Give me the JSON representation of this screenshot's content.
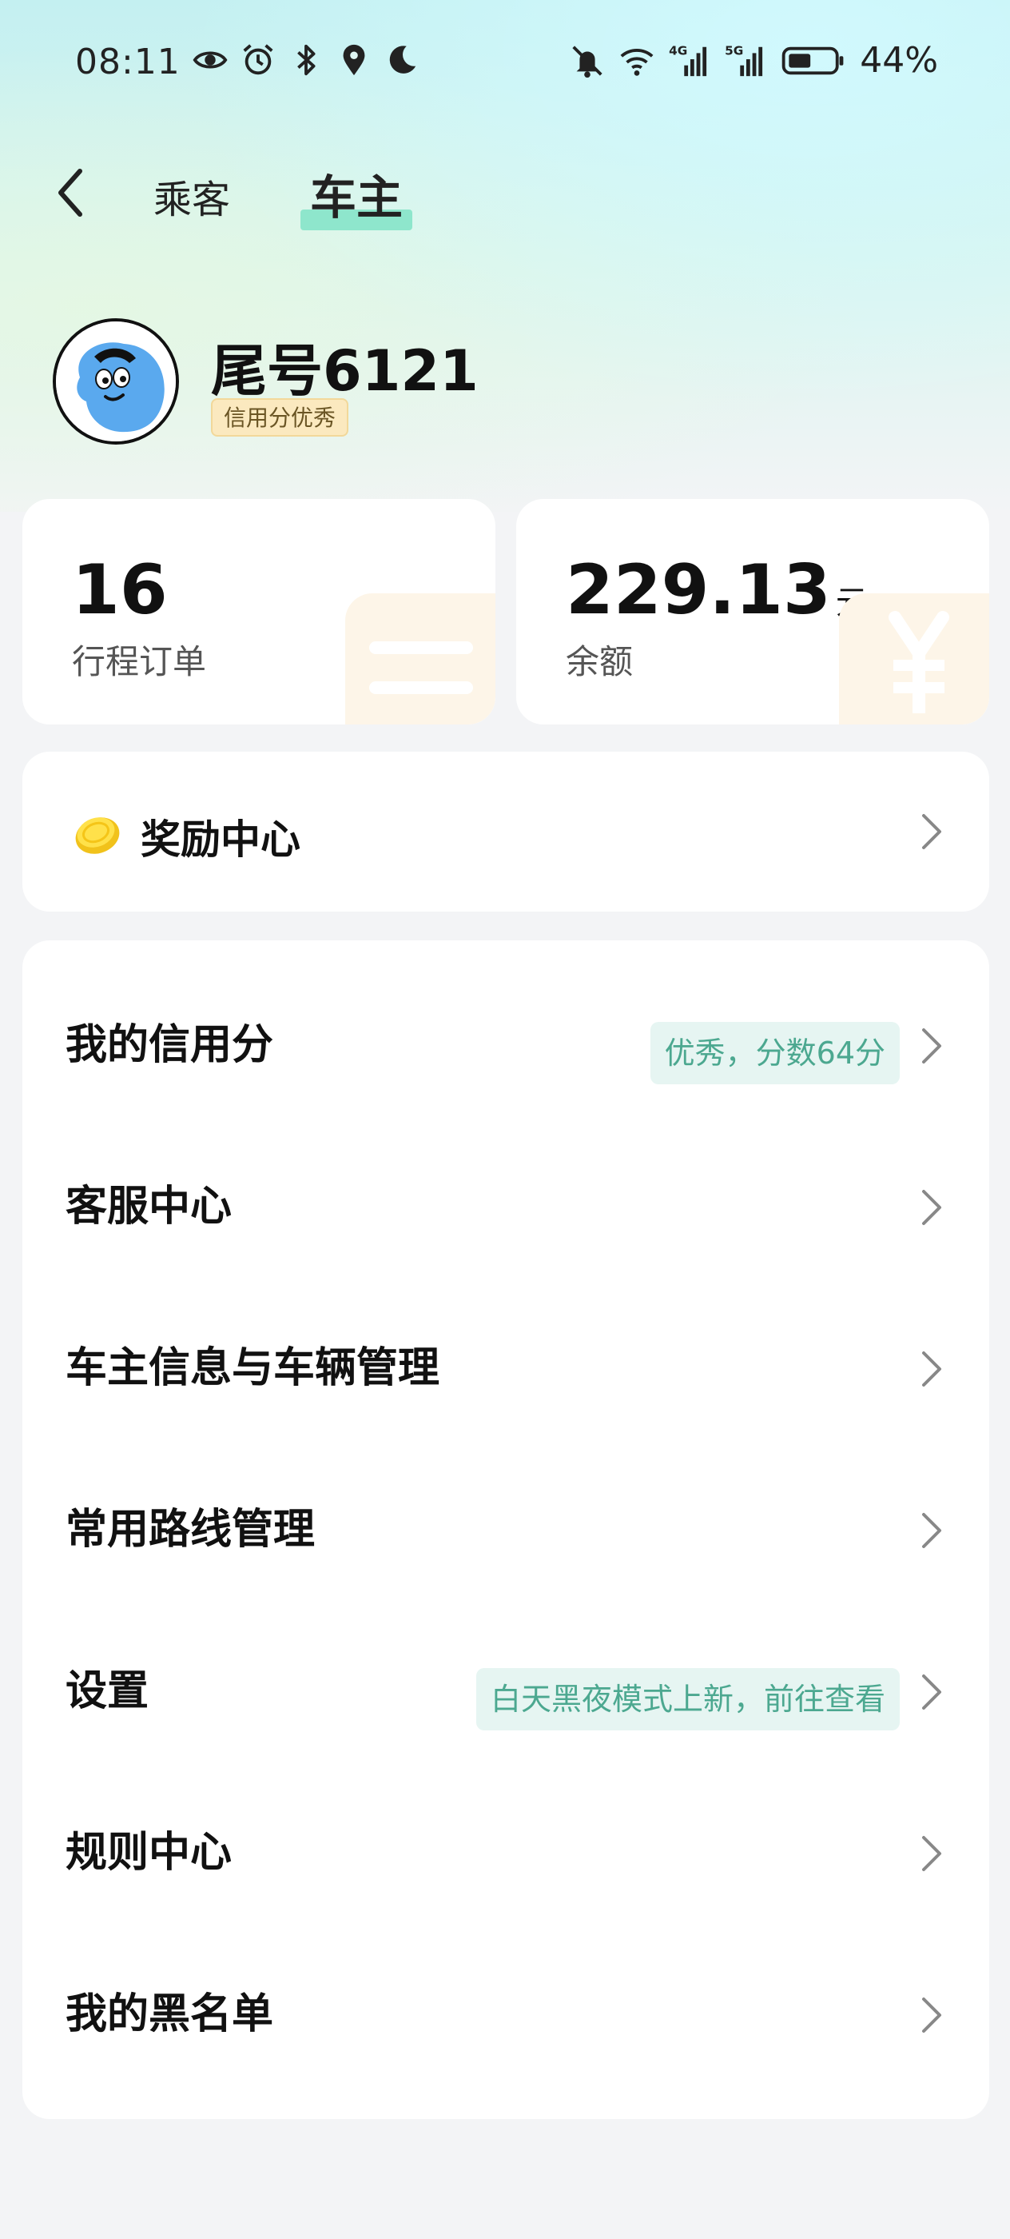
{
  "status_bar": {
    "time": "08:11",
    "battery_percent": "44%",
    "left_icons": [
      "eye-icon",
      "alarm-icon",
      "bluetooth-icon",
      "location-icon",
      "moon-icon"
    ],
    "right_icons": [
      "mute-icon",
      "wifi-icon",
      "signal-4g-icon",
      "signal-5g-icon",
      "battery-icon"
    ],
    "network_4g": "4G",
    "network_5g": "5G"
  },
  "tabs": {
    "passenger": "乘客",
    "driver": "车主",
    "active": "driver",
    "accent_color": "#8ee6cc"
  },
  "profile": {
    "name": "尾号6121",
    "credit_badge": "信用分优秀"
  },
  "stats": [
    {
      "value": "16",
      "unit": "",
      "label": "行程订单",
      "deco_icon": "list-icon"
    },
    {
      "value": "229.13",
      "unit": "元",
      "label": "余额",
      "deco_icon": "yuan-icon"
    }
  ],
  "rewards": {
    "label": "奖励中心",
    "icon": "coin-icon"
  },
  "menu": [
    {
      "label": "我的信用分",
      "tag": "优秀，分数64分"
    },
    {
      "label": "客服中心",
      "tag": ""
    },
    {
      "label": "车主信息与车辆管理",
      "tag": ""
    },
    {
      "label": "常用路线管理",
      "tag": ""
    },
    {
      "label": "设置",
      "tag": "白天黑夜模式上新，前往查看"
    },
    {
      "label": "规则中心",
      "tag": ""
    },
    {
      "label": "我的黑名单",
      "tag": ""
    }
  ],
  "colors": {
    "tag_bg": "#e6f5f2",
    "tag_text": "#4ca890",
    "badge_bg": "#fbe9bf"
  }
}
